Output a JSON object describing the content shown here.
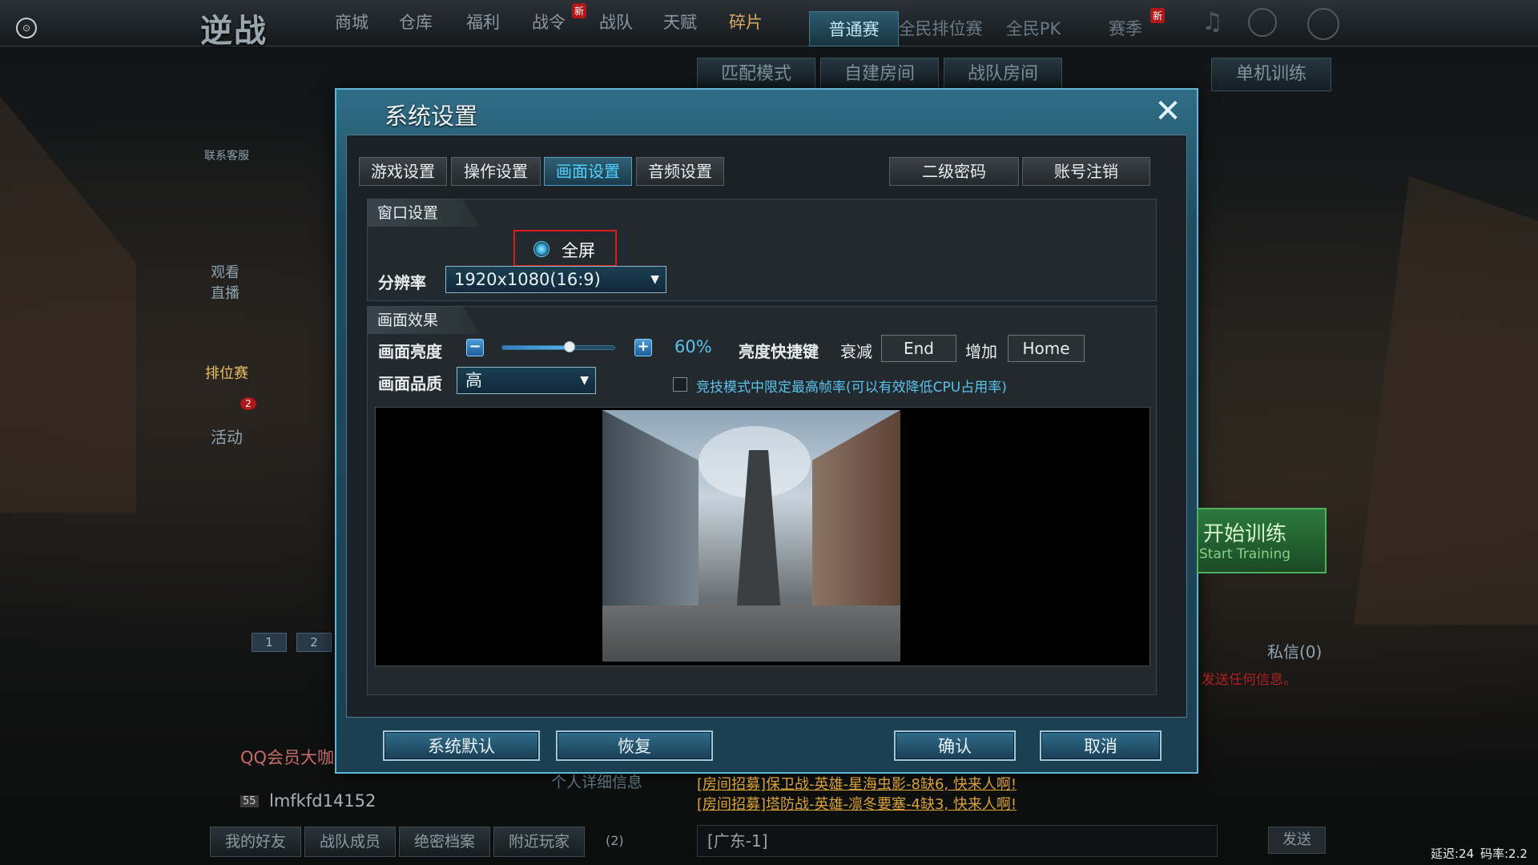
{
  "window": {
    "game_logo": "逆战"
  },
  "top_nav": {
    "items": [
      "商城",
      "仓库",
      "福利",
      "战令",
      "战队",
      "天赋",
      "碎片"
    ],
    "new_badge": "新",
    "mode_tabs": [
      "普通赛",
      "全民排位赛",
      "全民PK",
      "赛季"
    ]
  },
  "sub_tabs": [
    "匹配模式",
    "自建房间",
    "战队房间",
    "单机训练"
  ],
  "left_side": {
    "customer_service": "联系客服",
    "watch_live": "观看直播",
    "ranking": "排位赛",
    "activity": "活动",
    "activity_count": "2"
  },
  "dialog": {
    "title": "系统设置",
    "tabs": [
      "游戏设置",
      "操作设置",
      "画面设置",
      "音频设置"
    ],
    "active_tab": "画面设置",
    "right_tabs": [
      "二级密码",
      "账号注销"
    ],
    "window_section": {
      "header": "窗口设置",
      "fullscreen_label": "全屏",
      "resolution_label": "分辨率",
      "resolution_value": "1920x1080(16:9)"
    },
    "effect_section": {
      "header": "画面效果",
      "brightness_label": "画面亮度",
      "brightness_percent": "60%",
      "brightness_value": 0.6,
      "hotkey_label": "亮度快捷键",
      "decrease_label": "衰减",
      "decrease_key": "End",
      "increase_label": "增加",
      "increase_key": "Home",
      "quality_label": "画面品质",
      "quality_value": "高",
      "fps_limit_label": "竞技模式中限定最高帧率(可以有效降低CPU占用率)"
    },
    "buttons": {
      "system_default": "系统默认",
      "restore": "恢复",
      "confirm": "确认",
      "cancel": "取消"
    }
  },
  "right_panel": {
    "start_training_cn": "开始训练",
    "start_training_en": "Start Training",
    "messages": "私信(0)",
    "hint": "发送任何信息。"
  },
  "chat": {
    "lines": [
      "[房间招募]保卫战-英雄-星海虫影-8缺6, 快来人啊!",
      "[房间招募]塔防战-英雄-凛冬要塞-4缺3, 快来人啊!"
    ],
    "channel": "[广东-1]",
    "send": "发送"
  },
  "status": {
    "latency": "延迟:24",
    "bitrate": "码率:2.2"
  },
  "bottom_left": {
    "tabs": [
      "我的好友",
      "战队成员",
      "绝密档案",
      "附近玩家"
    ],
    "count": "(2)",
    "qq_member": "QQ会员大咖",
    "user_name": "lmfkfd14152",
    "user_level": "55",
    "pages": [
      "1",
      "2"
    ],
    "detail_link": "个人详细信息"
  },
  "colors": {
    "accent": "#4fd2ff",
    "highlight_border": "#e01b1b",
    "chat_orange": "#d9a13a"
  }
}
